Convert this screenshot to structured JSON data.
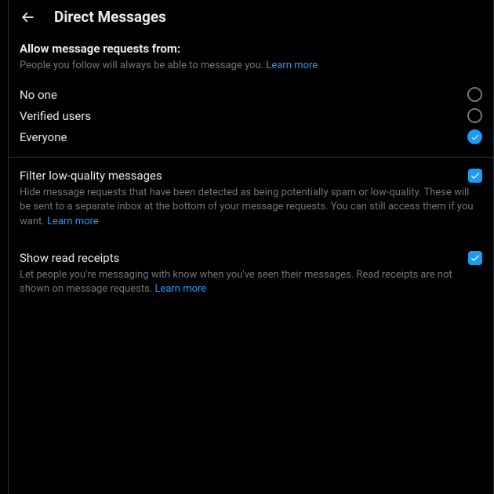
{
  "header": {
    "title": "Direct Messages"
  },
  "allowRequests": {
    "title": "Allow message requests from:",
    "description": "People you follow will always be able to message you. ",
    "learnMore": "Learn more",
    "options": {
      "noOne": "No one",
      "verified": "Verified users",
      "everyone": "Everyone"
    },
    "selected": "everyone"
  },
  "filterLowQuality": {
    "title": "Filter low-quality messages",
    "description": "Hide message requests that have been detected as being potentially spam or low-quality. These will be sent to a separate inbox at the bottom of your message requests. You can still access them if you want. ",
    "learnMore": "Learn more",
    "checked": true
  },
  "readReceipts": {
    "title": "Show read receipts",
    "description": "Let people you're messaging with know when you've seen their messages. Read receipts are not shown on message requests. ",
    "learnMore": "Learn more",
    "checked": true
  }
}
